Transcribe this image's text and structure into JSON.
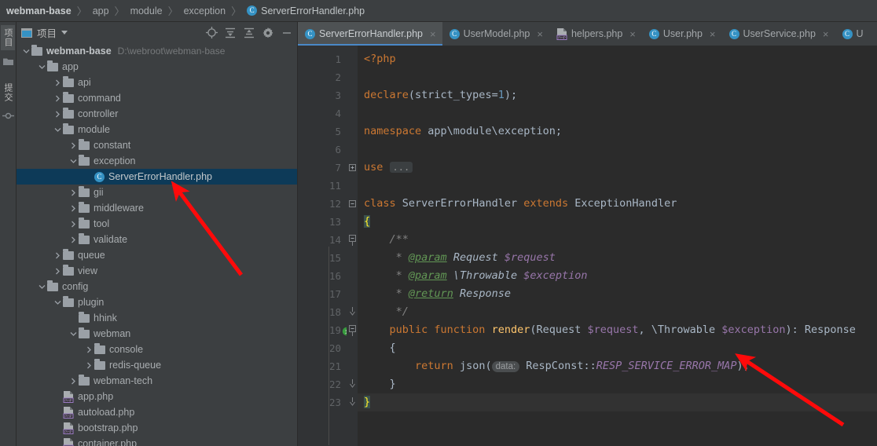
{
  "breadcrumb": {
    "root": "webman-base",
    "parts": [
      "app",
      "module",
      "exception"
    ],
    "file": "ServerErrorHandler.php",
    "separator": "〉",
    "class_icon": "C"
  },
  "toolstrip": {
    "project_tab": "项目",
    "commit_tab": "提交",
    "folder_icon": "folder-icon",
    "structure_icon": "structure-icon"
  },
  "project_panel": {
    "title": "项目",
    "icons": [
      "locate-icon",
      "expand-all-icon",
      "collapse-all-icon",
      "settings-icon",
      "hide-icon"
    ],
    "tree": [
      {
        "label": "webman-base",
        "path": "D:\\webroot\\webman-base",
        "indent": 0,
        "arrow": "down",
        "icon": "folder",
        "bold": true
      },
      {
        "label": "app",
        "indent": 1,
        "arrow": "down",
        "icon": "folder"
      },
      {
        "label": "api",
        "indent": 2,
        "arrow": "right",
        "icon": "folder"
      },
      {
        "label": "command",
        "indent": 2,
        "arrow": "right",
        "icon": "folder"
      },
      {
        "label": "controller",
        "indent": 2,
        "arrow": "right",
        "icon": "folder"
      },
      {
        "label": "module",
        "indent": 2,
        "arrow": "down",
        "icon": "folder"
      },
      {
        "label": "constant",
        "indent": 3,
        "arrow": "right",
        "icon": "folder"
      },
      {
        "label": "exception",
        "indent": 3,
        "arrow": "down",
        "icon": "folder"
      },
      {
        "label": "ServerErrorHandler.php",
        "indent": 4,
        "arrow": "none",
        "icon": "class",
        "selected": true
      },
      {
        "label": "gii",
        "indent": 3,
        "arrow": "right",
        "icon": "folder"
      },
      {
        "label": "middleware",
        "indent": 3,
        "arrow": "right",
        "icon": "folder"
      },
      {
        "label": "tool",
        "indent": 3,
        "arrow": "right",
        "icon": "folder"
      },
      {
        "label": "validate",
        "indent": 3,
        "arrow": "right",
        "icon": "folder"
      },
      {
        "label": "queue",
        "indent": 2,
        "arrow": "right",
        "icon": "folder"
      },
      {
        "label": "view",
        "indent": 2,
        "arrow": "right",
        "icon": "folder"
      },
      {
        "label": "config",
        "indent": 1,
        "arrow": "down",
        "icon": "folder"
      },
      {
        "label": "plugin",
        "indent": 2,
        "arrow": "down",
        "icon": "folder"
      },
      {
        "label": "hhink",
        "indent": 3,
        "arrow": "none",
        "icon": "folder"
      },
      {
        "label": "webman",
        "indent": 3,
        "arrow": "down",
        "icon": "folder"
      },
      {
        "label": "console",
        "indent": 4,
        "arrow": "right",
        "icon": "folder"
      },
      {
        "label": "redis-queue",
        "indent": 4,
        "arrow": "right",
        "icon": "folder"
      },
      {
        "label": "webman-tech",
        "indent": 3,
        "arrow": "right",
        "icon": "folder"
      },
      {
        "label": "app.php",
        "indent": 2,
        "arrow": "none",
        "icon": "php"
      },
      {
        "label": "autoload.php",
        "indent": 2,
        "arrow": "none",
        "icon": "php"
      },
      {
        "label": "bootstrap.php",
        "indent": 2,
        "arrow": "none",
        "icon": "php"
      },
      {
        "label": "container.php",
        "indent": 2,
        "arrow": "none",
        "icon": "php"
      }
    ]
  },
  "tabs": [
    {
      "label": "ServerErrorHandler.php",
      "icon": "class",
      "active": true,
      "close": "×"
    },
    {
      "label": "UserModel.php",
      "icon": "class",
      "active": false,
      "close": "×"
    },
    {
      "label": "helpers.php",
      "icon": "php",
      "active": false,
      "close": "×"
    },
    {
      "label": "User.php",
      "icon": "class",
      "active": false,
      "close": "×"
    },
    {
      "label": "UserService.php",
      "icon": "class",
      "active": false,
      "close": "×"
    },
    {
      "label": "U",
      "icon": "class",
      "active": false,
      "close": ""
    }
  ],
  "editor": {
    "line_numbers": [
      "1",
      "2",
      "3",
      "4",
      "5",
      "6",
      "7",
      "11",
      "12",
      "13",
      "14",
      "15",
      "16",
      "17",
      "18",
      "19",
      "20",
      "21",
      "22",
      "23"
    ],
    "gutter_mark_line": "19",
    "gutter_mark_count": "1",
    "code_lines": [
      "<?php",
      "",
      "declare(strict_types=1);",
      "",
      "namespace app\\module\\exception;",
      "",
      "use ...",
      "",
      "class ServerErrorHandler extends ExceptionHandler",
      "{",
      "    /**",
      "     * @param Request $request",
      "     * @param \\Throwable $exception",
      "     * @return Response",
      "     */",
      "    public function render(Request $request, \\Throwable $exception): Response",
      "    {",
      "        return json( data: RespConst::RESP_SERVICE_ERROR_MAP);",
      "    }",
      "}"
    ],
    "fold_placeholder": "...",
    "param_hint": "data:",
    "current_line": "23"
  },
  "annotations": [
    {
      "name": "arrow-to-selected-file",
      "color": "#FF0A0A"
    },
    {
      "name": "arrow-to-json-call",
      "color": "#FF0A0A"
    }
  ],
  "colors": {
    "accent_blue": "#3592C4",
    "tab_underline": "#4A88C7",
    "selection": "#0D3A58",
    "editor_bg": "#2B2B2B",
    "panel_bg": "#3C3F41",
    "keyword": "#CC7832",
    "variable": "#9876AA",
    "doc_tag": "#629755",
    "number": "#6897BB",
    "annotation_red": "#FF0A0A"
  }
}
